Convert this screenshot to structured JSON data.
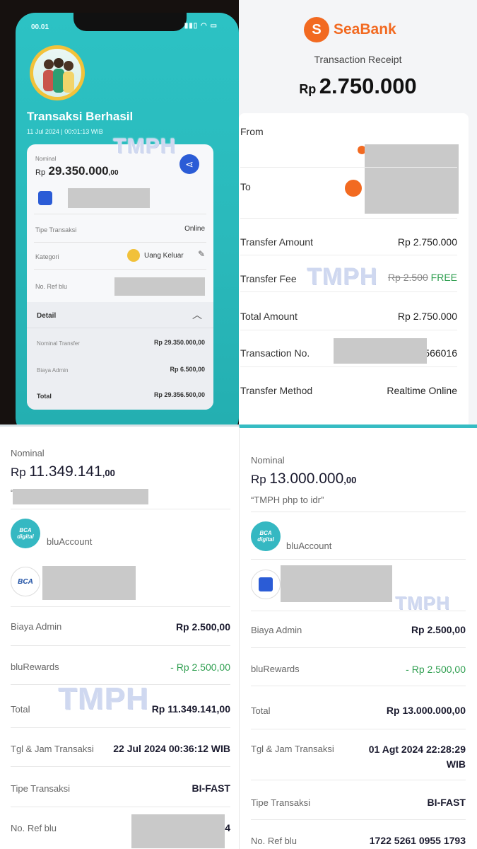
{
  "watermark": "TMPH",
  "q1": {
    "time": "00.01",
    "title": "Transaksi Berhasil",
    "date": "11 Jul 2024 | 00:01:13 WIB",
    "nominal_label": "Nominal",
    "nominal_currency": "Rp",
    "nominal_value": "29.350.000",
    "nominal_cents": ",00",
    "type_label": "Tipe Transaksi",
    "type_value": "Online",
    "category_label": "Kategori",
    "category_value": "Uang Keluar",
    "ref_label": "No. Ref blu",
    "detail_label": "Detail",
    "transfer_label": "Nominal Transfer",
    "transfer_value": "Rp 29.350.000,00",
    "admin_label": "Biaya Admin",
    "admin_value": "Rp 6.500,00",
    "total_label": "Total",
    "total_value": "Rp 29.356.500,00"
  },
  "q2": {
    "brand": "SeaBank",
    "subtitle": "Transaction Receipt",
    "currency": "Rp",
    "amount": "2.750.000",
    "from_label": "From",
    "to_label": "To",
    "transfer_amount_label": "Transfer Amount",
    "transfer_amount_value": "Rp 2.750.000",
    "fee_label": "Transfer Fee",
    "fee_old": "Rp 2.500",
    "fee_free": "FREE",
    "total_label": "Total Amount",
    "total_value": "Rp 2.750.000",
    "txn_label": "Transaction No.",
    "txn_suffix": "566016",
    "method_label": "Transfer Method",
    "method_value": "Realtime Online"
  },
  "q3": {
    "nominal_label": "Nominal",
    "currency": "Rp",
    "value": "11.349.141",
    "cents": ",00",
    "note": "“",
    "account_label": "bluAccount",
    "admin_label": "Biaya Admin",
    "admin_value": "Rp 2.500,00",
    "rewards_label": "bluRewards",
    "rewards_value": "- Rp 2.500,00",
    "total_label": "Total",
    "total_value": "Rp 11.349.141,00",
    "datetime_label": "Tgl & Jam Transaksi",
    "datetime_value": "22 Jul 2024 00:36:12 WIB",
    "type_label": "Tipe Transaksi",
    "type_value": "BI-FAST",
    "ref_label": "No. Ref blu",
    "ref_suffix": "4"
  },
  "q4": {
    "nominal_label": "Nominal",
    "currency": "Rp",
    "value": "13.000.000",
    "cents": ",00",
    "note": "“TMPH php to idr”",
    "account_label": "bluAccount",
    "admin_label": "Biaya Admin",
    "admin_value": "Rp 2.500,00",
    "rewards_label": "bluRewards",
    "rewards_value": "- Rp 2.500,00",
    "total_label": "Total",
    "total_value": "Rp 13.000.000,00",
    "datetime_label": "Tgl & Jam Transaksi",
    "datetime_value_1": "01 Agt 2024 22:28:29",
    "datetime_value_2": "WIB",
    "type_label": "Tipe Transaksi",
    "type_value": "BI-FAST",
    "ref_label": "No. Ref blu",
    "ref_value": "1722 5261 0955 1793"
  },
  "bank_labels": {
    "bca_digital_1": "BCA",
    "bca_digital_2": "digital",
    "bca": "BCA"
  },
  "colors": {
    "teal": "#2cc2c4",
    "seabank_orange": "#f26a21",
    "free_green": "#2e9e4f",
    "rewards_green": "#2e9e4f",
    "dark_text": "#1a1a2e"
  }
}
